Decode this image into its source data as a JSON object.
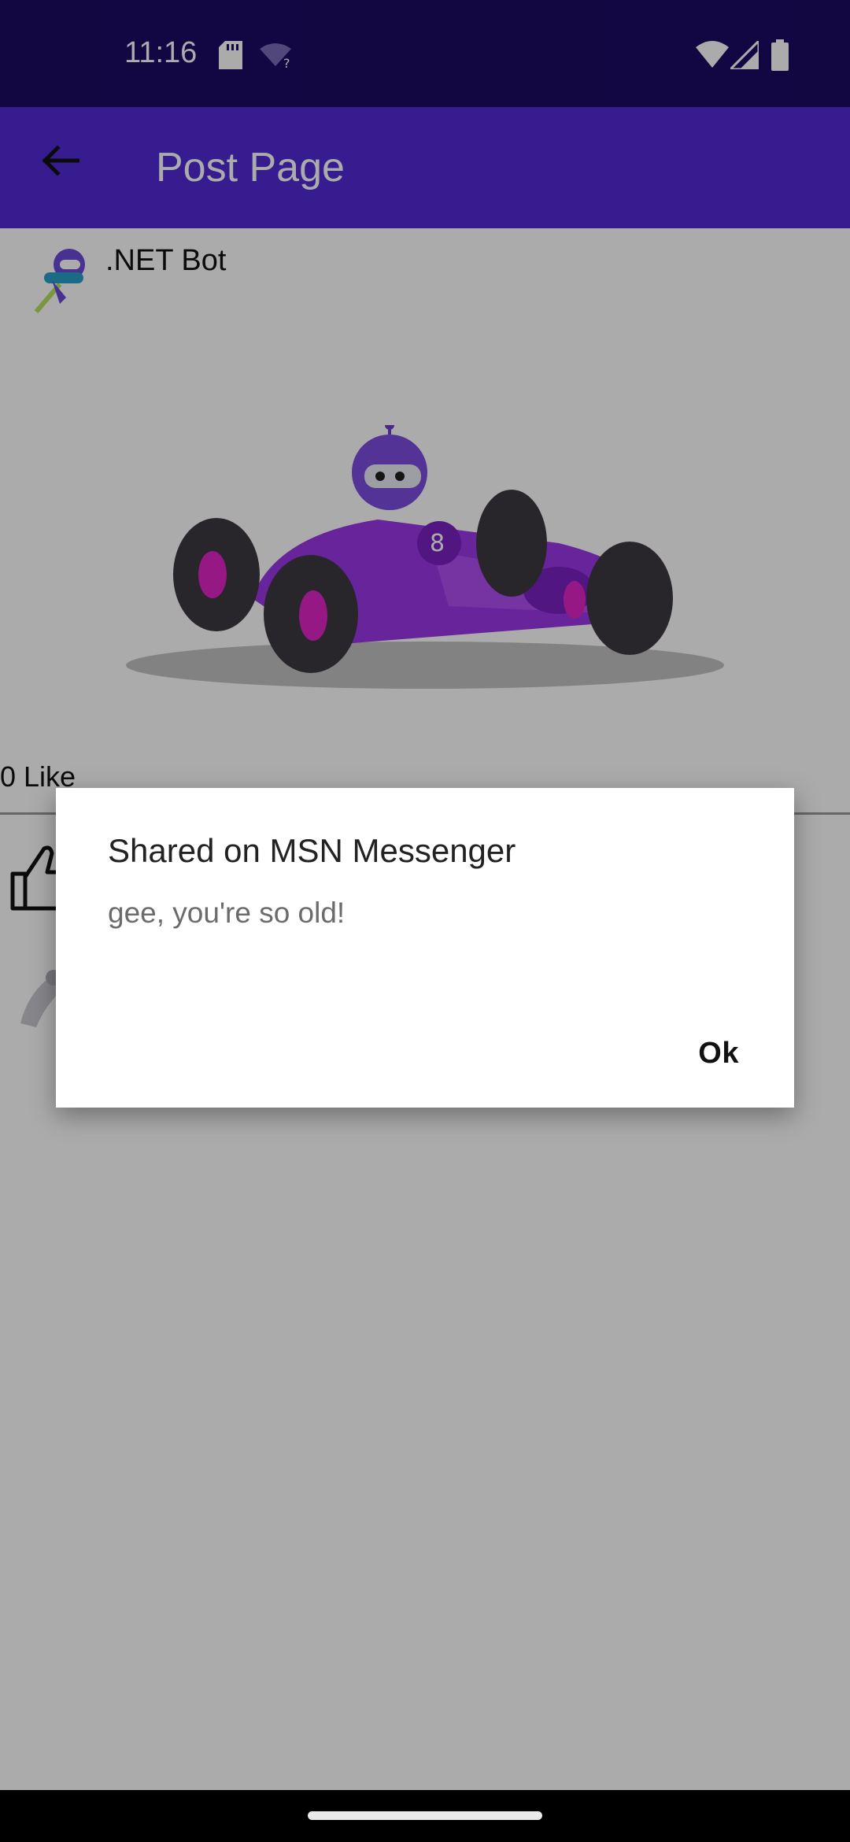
{
  "status_bar": {
    "time": "11:16",
    "icons": [
      "sd-card-icon",
      "wifi-question-icon",
      "wifi-icon",
      "signal-icon",
      "battery-icon"
    ]
  },
  "app_bar": {
    "title": "Post Page",
    "back_icon": "arrow-left-icon"
  },
  "post": {
    "author": ".NET Bot",
    "like_count": "0 Like"
  },
  "dialog": {
    "title": "Shared on MSN Messenger",
    "message": "gee, you're so old!",
    "ok_label": "Ok"
  },
  "colors": {
    "status_bar": "#1c0b63",
    "app_bar": "#512bd4",
    "accent_purple": "#8a2be2",
    "scrim": "rgba(0,0,0,0.33)"
  }
}
